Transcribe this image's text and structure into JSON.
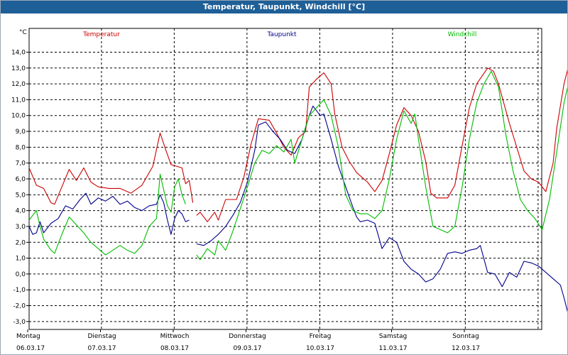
{
  "window": {
    "title": "Temperatur, Taupunkt, Windchill [°C]"
  },
  "chart_data": {
    "type": "line",
    "title": "Temperatur, Taupunkt, Windchill [°C]",
    "unit_label": "°C",
    "ylim": [
      -3.5,
      15.5
    ],
    "y_ticks": [
      "14,0",
      "13,0",
      "12,0",
      "11,0",
      "10,0",
      "9,0",
      "8,0",
      "7,0",
      "6,0",
      "5,0",
      "4,0",
      "3,0",
      "2,0",
      "1,0",
      "0,0",
      "-1,0",
      "-2,0",
      "-3,0"
    ],
    "y_tick_values": [
      14,
      13,
      12,
      11,
      10,
      9,
      8,
      7,
      6,
      5,
      4,
      3,
      2,
      1,
      0,
      -1,
      -2,
      -3
    ],
    "grid": true,
    "x_range": [
      0,
      7.2
    ],
    "x_ticks": [
      {
        "day": "Montag",
        "date": "06.03.17"
      },
      {
        "day": "Dienstag",
        "date": "07.03.17"
      },
      {
        "day": "Mittwoch",
        "date": "08.03.17"
      },
      {
        "day": "Donnerstag",
        "date": "09.03.17"
      },
      {
        "day": "Freitag",
        "date": "10.03.17"
      },
      {
        "day": "Samstag",
        "date": "11.03.17"
      },
      {
        "day": "Sonntag",
        "date": "12.03.17"
      }
    ],
    "series": [
      {
        "name": "Temperatur",
        "color": "#cc0000",
        "segments": [
          [
            [
              0.0,
              6.7
            ],
            [
              0.1,
              5.6
            ],
            [
              0.2,
              5.4
            ],
            [
              0.3,
              4.5
            ],
            [
              0.35,
              4.4
            ],
            [
              0.45,
              5.5
            ],
            [
              0.55,
              6.6
            ],
            [
              0.65,
              5.9
            ],
            [
              0.75,
              6.7
            ],
            [
              0.85,
              5.8
            ],
            [
              0.95,
              5.5
            ],
            [
              1.1,
              5.4
            ],
            [
              1.25,
              5.4
            ],
            [
              1.4,
              5.1
            ],
            [
              1.55,
              5.6
            ],
            [
              1.7,
              6.8
            ],
            [
              1.8,
              8.9
            ],
            [
              1.88,
              7.8
            ],
            [
              1.95,
              6.9
            ],
            [
              2.1,
              6.7
            ],
            [
              2.15,
              5.7
            ],
            [
              2.2,
              5.9
            ],
            [
              2.25,
              4.5
            ]
          ],
          [
            [
              2.3,
              3.7
            ],
            [
              2.35,
              3.9
            ],
            [
              2.45,
              3.3
            ],
            [
              2.55,
              3.9
            ],
            [
              2.6,
              3.4
            ],
            [
              2.7,
              4.7
            ],
            [
              2.85,
              4.7
            ],
            [
              2.95,
              6.1
            ],
            [
              3.05,
              8.2
            ],
            [
              3.15,
              9.8
            ],
            [
              3.3,
              9.7
            ],
            [
              3.4,
              8.9
            ],
            [
              3.5,
              8.0
            ],
            [
              3.6,
              7.5
            ],
            [
              3.7,
              8.6
            ],
            [
              3.8,
              9.0
            ],
            [
              3.85,
              11.8
            ],
            [
              3.95,
              12.3
            ],
            [
              4.05,
              12.7
            ],
            [
              4.15,
              12.0
            ],
            [
              4.2,
              10.1
            ],
            [
              4.3,
              8.0
            ],
            [
              4.4,
              7.1
            ],
            [
              4.5,
              6.4
            ],
            [
              4.65,
              5.8
            ],
            [
              4.75,
              5.2
            ],
            [
              4.85,
              5.9
            ],
            [
              4.95,
              7.6
            ],
            [
              5.05,
              9.4
            ],
            [
              5.15,
              10.5
            ],
            [
              5.25,
              10.0
            ],
            [
              5.35,
              9.0
            ],
            [
              5.45,
              7.1
            ],
            [
              5.52,
              5.1
            ],
            [
              5.6,
              4.8
            ],
            [
              5.75,
              4.8
            ],
            [
              5.85,
              5.6
            ],
            [
              5.95,
              8.1
            ],
            [
              6.05,
              10.5
            ],
            [
              6.15,
              12.0
            ],
            [
              6.3,
              13.0
            ],
            [
              6.38,
              12.8
            ],
            [
              6.45,
              12.0
            ],
            [
              6.6,
              9.5
            ],
            [
              6.7,
              8.0
            ],
            [
              6.8,
              6.5
            ],
            [
              6.9,
              6.0
            ],
            [
              7.0,
              5.8
            ],
            [
              7.1,
              5.2
            ],
            [
              7.2,
              7.0
            ],
            [
              7.25,
              9.2
            ],
            [
              7.35,
              12.0
            ],
            [
              7.45,
              13.8
            ],
            [
              7.55,
              14.4
            ],
            [
              7.6,
              13.8
            ],
            [
              7.7,
              11.3
            ],
            [
              7.8,
              9.2
            ],
            [
              7.9,
              8.3
            ]
          ]
        ]
      },
      {
        "name": "Taupunkt",
        "color": "#00008b",
        "segments": [
          [
            [
              0.0,
              3.0
            ],
            [
              0.05,
              2.5
            ],
            [
              0.1,
              2.6
            ],
            [
              0.15,
              3.3
            ],
            [
              0.2,
              2.6
            ],
            [
              0.3,
              3.2
            ],
            [
              0.4,
              3.5
            ],
            [
              0.5,
              4.3
            ],
            [
              0.6,
              4.1
            ],
            [
              0.7,
              4.7
            ],
            [
              0.78,
              5.1
            ],
            [
              0.85,
              4.4
            ],
            [
              0.95,
              4.8
            ],
            [
              1.05,
              4.6
            ],
            [
              1.15,
              4.9
            ],
            [
              1.25,
              4.4
            ],
            [
              1.35,
              4.6
            ],
            [
              1.45,
              4.2
            ],
            [
              1.55,
              4.0
            ],
            [
              1.65,
              4.3
            ],
            [
              1.75,
              4.4
            ],
            [
              1.8,
              5.0
            ],
            [
              1.85,
              4.5
            ],
            [
              1.9,
              3.4
            ],
            [
              1.95,
              2.5
            ],
            [
              2.0,
              3.5
            ],
            [
              2.05,
              4.0
            ],
            [
              2.1,
              3.8
            ],
            [
              2.15,
              3.3
            ],
            [
              2.2,
              3.4
            ]
          ],
          [
            [
              2.3,
              1.9
            ],
            [
              2.4,
              1.8
            ],
            [
              2.5,
              2.1
            ],
            [
              2.6,
              2.5
            ],
            [
              2.7,
              3.0
            ],
            [
              2.8,
              3.7
            ],
            [
              2.9,
              4.5
            ],
            [
              3.0,
              5.8
            ],
            [
              3.1,
              7.8
            ],
            [
              3.15,
              9.4
            ],
            [
              3.25,
              9.6
            ],
            [
              3.35,
              9.0
            ],
            [
              3.45,
              8.5
            ],
            [
              3.55,
              7.8
            ],
            [
              3.65,
              7.6
            ],
            [
              3.75,
              8.5
            ],
            [
              3.85,
              10.0
            ],
            [
              3.9,
              10.6
            ],
            [
              4.0,
              10.0
            ],
            [
              4.05,
              10.1
            ],
            [
              4.15,
              8.5
            ],
            [
              4.25,
              6.8
            ],
            [
              4.35,
              5.5
            ],
            [
              4.45,
              4.2
            ],
            [
              4.5,
              3.6
            ],
            [
              4.55,
              3.3
            ],
            [
              4.65,
              3.4
            ],
            [
              4.75,
              3.2
            ],
            [
              4.85,
              1.6
            ],
            [
              4.95,
              2.3
            ],
            [
              5.05,
              2.0
            ],
            [
              5.15,
              0.8
            ],
            [
              5.25,
              0.3
            ],
            [
              5.35,
              0.0
            ],
            [
              5.45,
              -0.5
            ],
            [
              5.55,
              -0.3
            ],
            [
              5.65,
              0.3
            ],
            [
              5.75,
              1.3
            ],
            [
              5.85,
              1.4
            ],
            [
              5.95,
              1.3
            ],
            [
              6.05,
              1.5
            ],
            [
              6.15,
              1.6
            ],
            [
              6.2,
              1.8
            ],
            [
              6.3,
              0.1
            ],
            [
              6.4,
              0.0
            ],
            [
              6.5,
              -0.8
            ],
            [
              6.6,
              0.1
            ],
            [
              6.7,
              -0.2
            ],
            [
              6.8,
              0.8
            ],
            [
              6.9,
              0.7
            ],
            [
              7.0,
              0.5
            ],
            [
              7.1,
              0.1
            ],
            [
              7.2,
              -0.3
            ],
            [
              7.3,
              -0.7
            ],
            [
              7.35,
              -1.5
            ],
            [
              7.4,
              -2.4
            ],
            [
              7.45,
              -2.7
            ],
            [
              7.5,
              -1.8
            ],
            [
              7.55,
              -0.5
            ],
            [
              7.65,
              -0.2
            ],
            [
              7.75,
              -0.3
            ],
            [
              7.82,
              -0.2
            ],
            [
              7.9,
              -0.7
            ]
          ]
        ]
      },
      {
        "name": "Windchill",
        "color": "#00bb00",
        "segments": [
          [
            [
              0.0,
              3.4
            ],
            [
              0.1,
              4.0
            ],
            [
              0.15,
              3.0
            ],
            [
              0.2,
              2.2
            ],
            [
              0.3,
              1.5
            ],
            [
              0.35,
              1.3
            ],
            [
              0.45,
              2.5
            ],
            [
              0.55,
              3.6
            ],
            [
              0.65,
              3.1
            ],
            [
              0.75,
              2.6
            ],
            [
              0.85,
              2.0
            ],
            [
              0.95,
              1.6
            ],
            [
              1.05,
              1.2
            ],
            [
              1.15,
              1.5
            ],
            [
              1.25,
              1.8
            ],
            [
              1.35,
              1.5
            ],
            [
              1.45,
              1.3
            ],
            [
              1.55,
              1.8
            ],
            [
              1.65,
              3.0
            ],
            [
              1.75,
              3.5
            ],
            [
              1.8,
              6.3
            ],
            [
              1.85,
              5.3
            ],
            [
              1.9,
              4.3
            ],
            [
              1.95,
              3.9
            ],
            [
              2.0,
              5.5
            ],
            [
              2.05,
              6.0
            ],
            [
              2.1,
              5.0
            ],
            [
              2.15,
              4.4
            ]
          ],
          [
            [
              2.3,
              1.2
            ],
            [
              2.35,
              0.9
            ],
            [
              2.45,
              1.6
            ],
            [
              2.55,
              1.2
            ],
            [
              2.6,
              2.1
            ],
            [
              2.7,
              1.5
            ],
            [
              2.8,
              2.7
            ],
            [
              2.9,
              4.1
            ],
            [
              3.0,
              5.5
            ],
            [
              3.1,
              7.0
            ],
            [
              3.2,
              7.8
            ],
            [
              3.3,
              7.6
            ],
            [
              3.4,
              8.1
            ],
            [
              3.5,
              7.7
            ],
            [
              3.6,
              8.5
            ],
            [
              3.65,
              7.0
            ],
            [
              3.75,
              8.5
            ],
            [
              3.8,
              9.3
            ],
            [
              3.85,
              10.0
            ],
            [
              3.95,
              10.5
            ],
            [
              4.05,
              11.0
            ],
            [
              4.15,
              10.0
            ],
            [
              4.25,
              8.0
            ],
            [
              4.35,
              5.0
            ],
            [
              4.45,
              4.0
            ],
            [
              4.55,
              3.8
            ],
            [
              4.65,
              3.8
            ],
            [
              4.75,
              3.5
            ],
            [
              4.85,
              4.0
            ],
            [
              4.95,
              6.0
            ],
            [
              5.05,
              8.5
            ],
            [
              5.15,
              10.3
            ],
            [
              5.25,
              9.5
            ],
            [
              5.3,
              10.1
            ],
            [
              5.35,
              8.5
            ],
            [
              5.45,
              5.5
            ],
            [
              5.55,
              3.0
            ],
            [
              5.65,
              2.8
            ],
            [
              5.75,
              2.6
            ],
            [
              5.85,
              3.0
            ],
            [
              5.95,
              5.5
            ],
            [
              6.05,
              8.5
            ],
            [
              6.15,
              10.8
            ],
            [
              6.25,
              12.0
            ],
            [
              6.35,
              12.8
            ],
            [
              6.45,
              11.8
            ],
            [
              6.55,
              8.8
            ],
            [
              6.65,
              6.5
            ],
            [
              6.75,
              4.7
            ],
            [
              6.85,
              4.0
            ],
            [
              6.95,
              3.5
            ],
            [
              7.05,
              2.8
            ],
            [
              7.15,
              4.7
            ],
            [
              7.25,
              7.7
            ],
            [
              7.35,
              10.8
            ],
            [
              7.45,
              12.8
            ],
            [
              7.55,
              13.8
            ],
            [
              7.65,
              12.0
            ],
            [
              7.75,
              9.5
            ],
            [
              7.85,
              7.5
            ],
            [
              7.9,
              7.0
            ]
          ]
        ]
      }
    ]
  }
}
